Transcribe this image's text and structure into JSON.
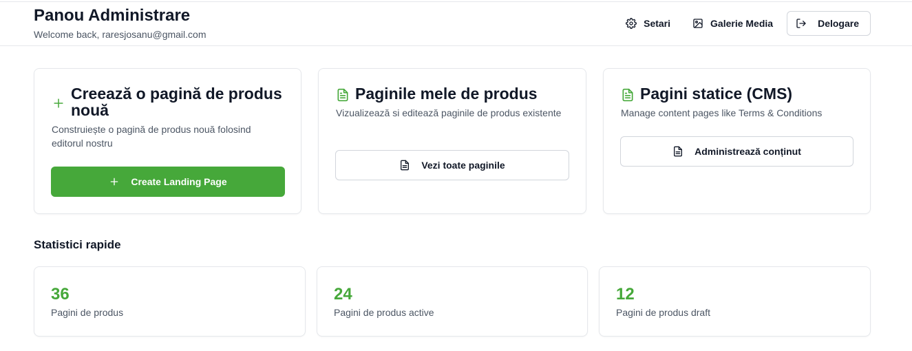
{
  "header": {
    "title": "Panou Administrare",
    "subtitle": "Welcome back, raresjosanu@gmail.com",
    "nav": {
      "settings_label": "Setari",
      "media_label": "Galerie Media",
      "logout_label": "Delogare"
    }
  },
  "cards": {
    "create": {
      "title": "Creează o pagină de produs nouă",
      "description": "Construiește o pagină de produs nouă folosind editorul nostru",
      "button_label": "Create Landing Page"
    },
    "my_pages": {
      "title": "Paginile mele de produs",
      "description": "Vizualizează si editează paginile de produs existente",
      "button_label": "Vezi toate paginile"
    },
    "cms": {
      "title": "Pagini statice (CMS)",
      "description": "Manage content pages like Terms & Conditions",
      "button_label": "Administrează conținut"
    }
  },
  "stats": {
    "section_title": "Statistici rapide",
    "items": [
      {
        "value": "36",
        "label": "Pagini de produs"
      },
      {
        "value": "24",
        "label": "Pagini de produs active"
      },
      {
        "value": "12",
        "label": "Pagini de produs draft"
      }
    ]
  },
  "icons": {
    "settings": "gear-icon",
    "media": "image-icon",
    "logout": "logout-icon",
    "plus": "plus-icon",
    "document": "file-text-icon"
  },
  "colors": {
    "accent": "#46a83a",
    "border": "#e5e7eb",
    "text": "#111827",
    "muted": "#4b5563"
  }
}
